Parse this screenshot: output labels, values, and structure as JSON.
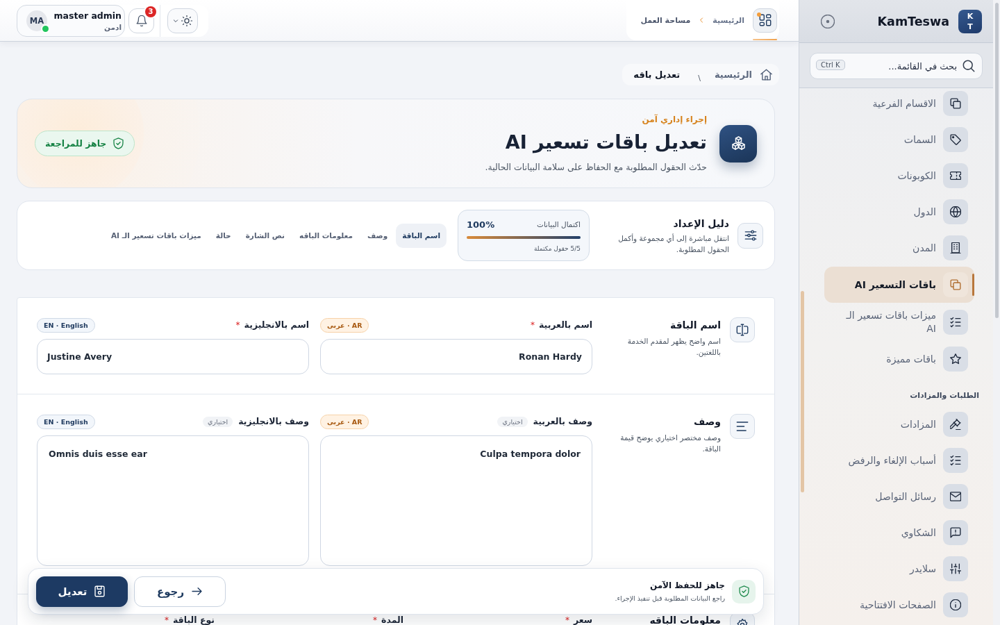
{
  "topbar": {
    "breadcrumb": [
      "الرئيسية",
      "مساحة العمل"
    ],
    "notifications": {
      "count": "3"
    },
    "user": {
      "initials": "MA",
      "name": "master admin",
      "role": "ادمن",
      "online": true
    }
  },
  "breadcrumb": {
    "items": [
      "الرئيسية",
      "تعديل باقه"
    ],
    "separator": "\\"
  },
  "hero": {
    "kicker": "إجراء إداري آمن",
    "title": "تعديل باقات تسعير AI",
    "subtitle": "حدّث الحقول المطلوبة مع الحفاظ على سلامة البيانات الحالية.",
    "status": "جاهز للمراجعة"
  },
  "guide": {
    "title": "دليل الإعداد",
    "description": "انتقل مباشرة إلى أي مجموعة وأكمل الحقول المطلوبة.",
    "progress": {
      "label": "اكتمال البيانات",
      "value": "100%",
      "level": 1,
      "caption": "5/5 حقول مكتملة"
    },
    "tabs": [
      {
        "label": "اسم الباقة",
        "selected": true
      },
      {
        "label": "وصف",
        "selected": false
      },
      {
        "label": "معلومات الباقه",
        "selected": false
      },
      {
        "label": "نص الشارة",
        "selected": false
      },
      {
        "label": "حالة",
        "selected": false
      },
      {
        "label": "ميزات باقات تسعير الـ AI",
        "selected": false
      }
    ]
  },
  "sections": [
    {
      "title": "اسم الباقة",
      "description": "اسم واضح يظهر لمقدم الخدمة باللغتين.",
      "fields": [
        {
          "kind": "input",
          "label": "اسم بالعربية",
          "required_mark": "*",
          "badge": {
            "kind": "ar",
            "text": "AR · عربى"
          },
          "value": "Ronan Hardy"
        },
        {
          "kind": "input",
          "label": "اسم بالانجليزية",
          "required_mark": "*",
          "badge": {
            "kind": "en",
            "text": "EN · English"
          },
          "value": "Justine Avery"
        }
      ]
    },
    {
      "title": "وصف",
      "description": "وصف مختصر اختياري يوضح قيمة الباقة.",
      "fields": [
        {
          "kind": "textarea",
          "label": "وصف بالعربية",
          "optional": "اختياري",
          "badge": {
            "kind": "ar",
            "text": "AR · عربى"
          },
          "value": "Culpa tempora dolor"
        },
        {
          "kind": "textarea",
          "label": "وصف بالانجليزية",
          "optional": "اختياري",
          "badge": {
            "kind": "en",
            "text": "EN · English"
          },
          "value": "Omnis duis esse ear"
        }
      ]
    },
    {
      "title": "معلومات الباقه",
      "fields": [
        {
          "label": "سعر",
          "required_mark": "*"
        },
        {
          "label": "المدة",
          "required_mark": "*"
        },
        {
          "label": "نوع الباقة",
          "required_mark": "*"
        }
      ]
    }
  ],
  "save_bar": {
    "title": "جاهز للحفظ الآمن",
    "hint": "راجع البيانات المطلوبة قبل تنفيذ الإجراء.",
    "buttons": [
      {
        "kind": "secondary",
        "label": "رجوع"
      },
      {
        "kind": "primary",
        "label": "تعديل"
      }
    ]
  },
  "sidebar": {
    "logo": [
      "K",
      "T"
    ],
    "brand": "KamTeswa",
    "search": {
      "placeholder": "بحث في القائمة...",
      "shortcut": "Ctrl K"
    },
    "items": [
      {
        "kind": "link",
        "label": "الاقسام الفرعية",
        "selected": false
      },
      {
        "kind": "link",
        "label": "السمات",
        "selected": false
      },
      {
        "kind": "link",
        "label": "الكوبونات",
        "selected": false
      },
      {
        "kind": "link",
        "label": "الدول",
        "selected": false
      },
      {
        "kind": "link",
        "label": "المدن",
        "selected": false
      },
      {
        "kind": "link",
        "label": "باقات التسعير AI",
        "selected": true
      },
      {
        "kind": "link",
        "label": "ميزات باقات تسعير الـ AI",
        "selected": false
      },
      {
        "kind": "link",
        "label": "باقات مميزة",
        "selected": false
      },
      {
        "kind": "header",
        "label": "الطلبات والمزادات"
      },
      {
        "kind": "link",
        "label": "المزادات",
        "selected": false
      },
      {
        "kind": "link",
        "label": "أسباب الإلغاء والرفض",
        "selected": false
      },
      {
        "kind": "link",
        "label": "رسائل التواصل",
        "selected": false
      },
      {
        "kind": "link",
        "label": "الشكاوي",
        "selected": false
      },
      {
        "kind": "link",
        "label": "سلايدر",
        "selected": false
      },
      {
        "kind": "link",
        "label": "الصفحات الافتتاحية",
        "selected": false
      }
    ]
  }
}
